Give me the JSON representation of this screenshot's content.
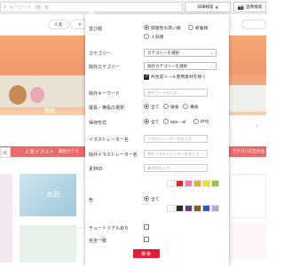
{
  "topbar": {
    "search_placeholder": "キーワード（例）秋",
    "detail_search_label": "詳細検索",
    "detail_search_arrow": "▼",
    "image_search_label": "画像検索",
    "camera_icon": "📷"
  },
  "background": {
    "chip_a": "0 奥",
    "chip_b": "キ",
    "chip_c": "",
    "hero_label": "梅雨",
    "hero_right_text": "",
    "ac_label": "AC",
    "section_title": "人気イラスト",
    "section_sub": "最新カテゴ",
    "right_section": "ラテゴリ広告の合",
    "thumb_text": "水彩"
  },
  "panel": {
    "sort": {
      "label": "並び順",
      "options": [
        "関連性の高い順",
        "新着順",
        "人気順"
      ],
      "selected": 0
    },
    "category": {
      "label": "カテゴリー",
      "value": "カテゴリーを選択"
    },
    "exclude_category": {
      "label": "除外カテゴリー",
      "value": "除外カテゴリーを選択"
    },
    "ai_exclude": {
      "label": "AI生成ツール使用素材を除く",
      "checked": true
    },
    "exclude_keyword": {
      "label": "除外キーワード",
      "placeholder": "除外ワードを入力"
    },
    "orientation": {
      "label": "縦長・横長の選択",
      "options": [
        "全て",
        "縦長",
        "横長"
      ],
      "selected": 0
    },
    "format": {
      "label": "保存形式",
      "options": [
        "全て",
        "eps・ai",
        "png"
      ],
      "selected": 0
    },
    "creator": {
      "label": "イラストレーター名",
      "placeholder": "イラストレーター名を入力"
    },
    "exclude_creator": {
      "label": "除外イラストレーター名",
      "placeholder": "除外イラストレーター名を入力"
    },
    "material_id": {
      "label": "素材ID",
      "placeholder": "素材IDを入力"
    },
    "color": {
      "label": "色",
      "all_label": "全て",
      "swatches_row1": [
        "#ffffff",
        "#e8202a",
        "#f07aa8",
        "#f6a623",
        "#f3e21d",
        "#8ccf3a"
      ],
      "swatches_row2": [
        "#ffffff",
        "#2a2a2a",
        "#6b3f86",
        "#8a5a2b",
        "#1e5bd7",
        "#b8a6d6"
      ]
    },
    "tutorial": {
      "label": "チュートリアルあり"
    },
    "exact_match": {
      "label": "完全一致"
    },
    "search_button": "検索"
  }
}
